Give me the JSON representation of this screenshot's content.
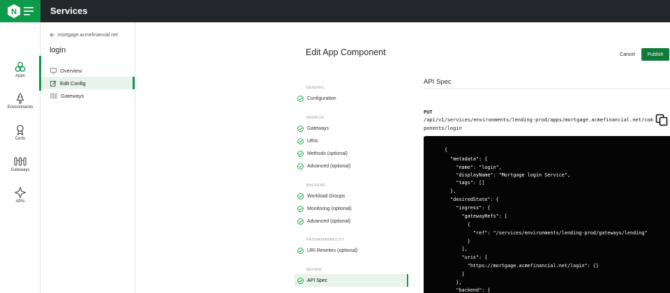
{
  "app": {
    "title": "Services",
    "logo_letter": "N"
  },
  "colors": {
    "brand_green": "#0e9a4b",
    "topbar": "#23262b",
    "publish": "#0f7a3a",
    "active_bg": "#e8f3ec",
    "code_bg": "#050505"
  },
  "rail": {
    "items": [
      {
        "label": "Apps",
        "icon": "apps-icon"
      },
      {
        "label": "Environments",
        "icon": "environments-icon"
      },
      {
        "label": "Certs",
        "icon": "certs-icon"
      },
      {
        "label": "Gateways",
        "icon": "gateways-icon"
      },
      {
        "label": "APIs",
        "icon": "apis-icon"
      }
    ],
    "active": "Apps"
  },
  "subnav": {
    "back_label": "mortgage.acmefinancial.net",
    "title": "login",
    "items": [
      {
        "label": "Overview",
        "icon": "monitor-icon"
      },
      {
        "label": "Edit Config",
        "icon": "edit-icon"
      },
      {
        "label": "Gateways",
        "icon": "gateways-icon"
      }
    ],
    "active": "Edit Config"
  },
  "main": {
    "title": "Edit App Component",
    "cancel_label": "Cancel",
    "publish_label": "Publish"
  },
  "steps": {
    "sections": [
      {
        "name": "GENERAL",
        "items": [
          "Configuration"
        ]
      },
      {
        "name": "INGRESS",
        "items": [
          "Gateways",
          "URIs",
          "Methods (optional)",
          "Advanced (optional)"
        ]
      },
      {
        "name": "BACKEND",
        "items": [
          "Workload Groups",
          "Monitoring (optional)",
          "Advanced (optional)"
        ]
      },
      {
        "name": "PROGRAMMABILITY",
        "items": [
          "URI Rewrites (optional)"
        ]
      },
      {
        "name": "REVIEW",
        "items": [
          "API Spec"
        ]
      }
    ],
    "active": "API Spec"
  },
  "spec": {
    "title": "API Spec",
    "method": "PUT",
    "endpoint": "/api/v1/services/environments/lending-prod/apps/mortgage.acmefinancial.net/components/login",
    "code_lines": [
      "{",
      "  \"metadata\": {",
      "    \"name\": \"login\",",
      "    \"displayName\": \"Mortgage login Service\",",
      "    \"tags\": []",
      "  },",
      "  \"desiredState\": {",
      "    \"ingress\": {",
      "      \"gatewayRefs\": [",
      "        {",
      "          \"ref\": \"/services/environments/lending-prod/gateways/lending\"",
      "        }",
      "      ],",
      "      \"uris\": {",
      "        \"https://mortgage.acmefinancial.net/login\": {}",
      "      }",
      "    },",
      "    \"backend\": {"
    ]
  }
}
